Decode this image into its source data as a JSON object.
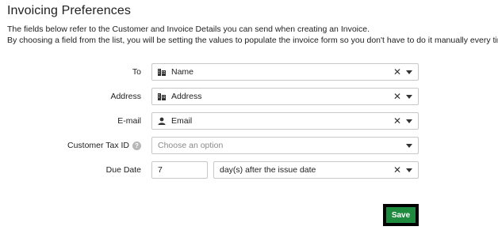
{
  "page": {
    "title": "Invoicing Preferences",
    "desc_line1": "The fields below refer to the Customer and Invoice Details you can send when creating an Invoice.",
    "desc_line2": "By choosing a field from the list, you will be setting the values to populate the invoice form so you don't have to do it manually every time."
  },
  "fields": {
    "to": {
      "label": "To",
      "value": "Name",
      "icon": "id-card-icon"
    },
    "address": {
      "label": "Address",
      "value": "Address",
      "icon": "id-card-icon"
    },
    "email": {
      "label": "E-mail",
      "value": "Email",
      "icon": "person-icon"
    },
    "tax_id": {
      "label": "Customer Tax ID",
      "placeholder": "Choose an option",
      "help": "?"
    },
    "due_date": {
      "label": "Due Date",
      "days": "7",
      "unit": "day(s) after the issue date"
    }
  },
  "glyphs": {
    "clear": "✕"
  },
  "save_label": "Save",
  "colors": {
    "save_button": "#1e8a3e"
  }
}
